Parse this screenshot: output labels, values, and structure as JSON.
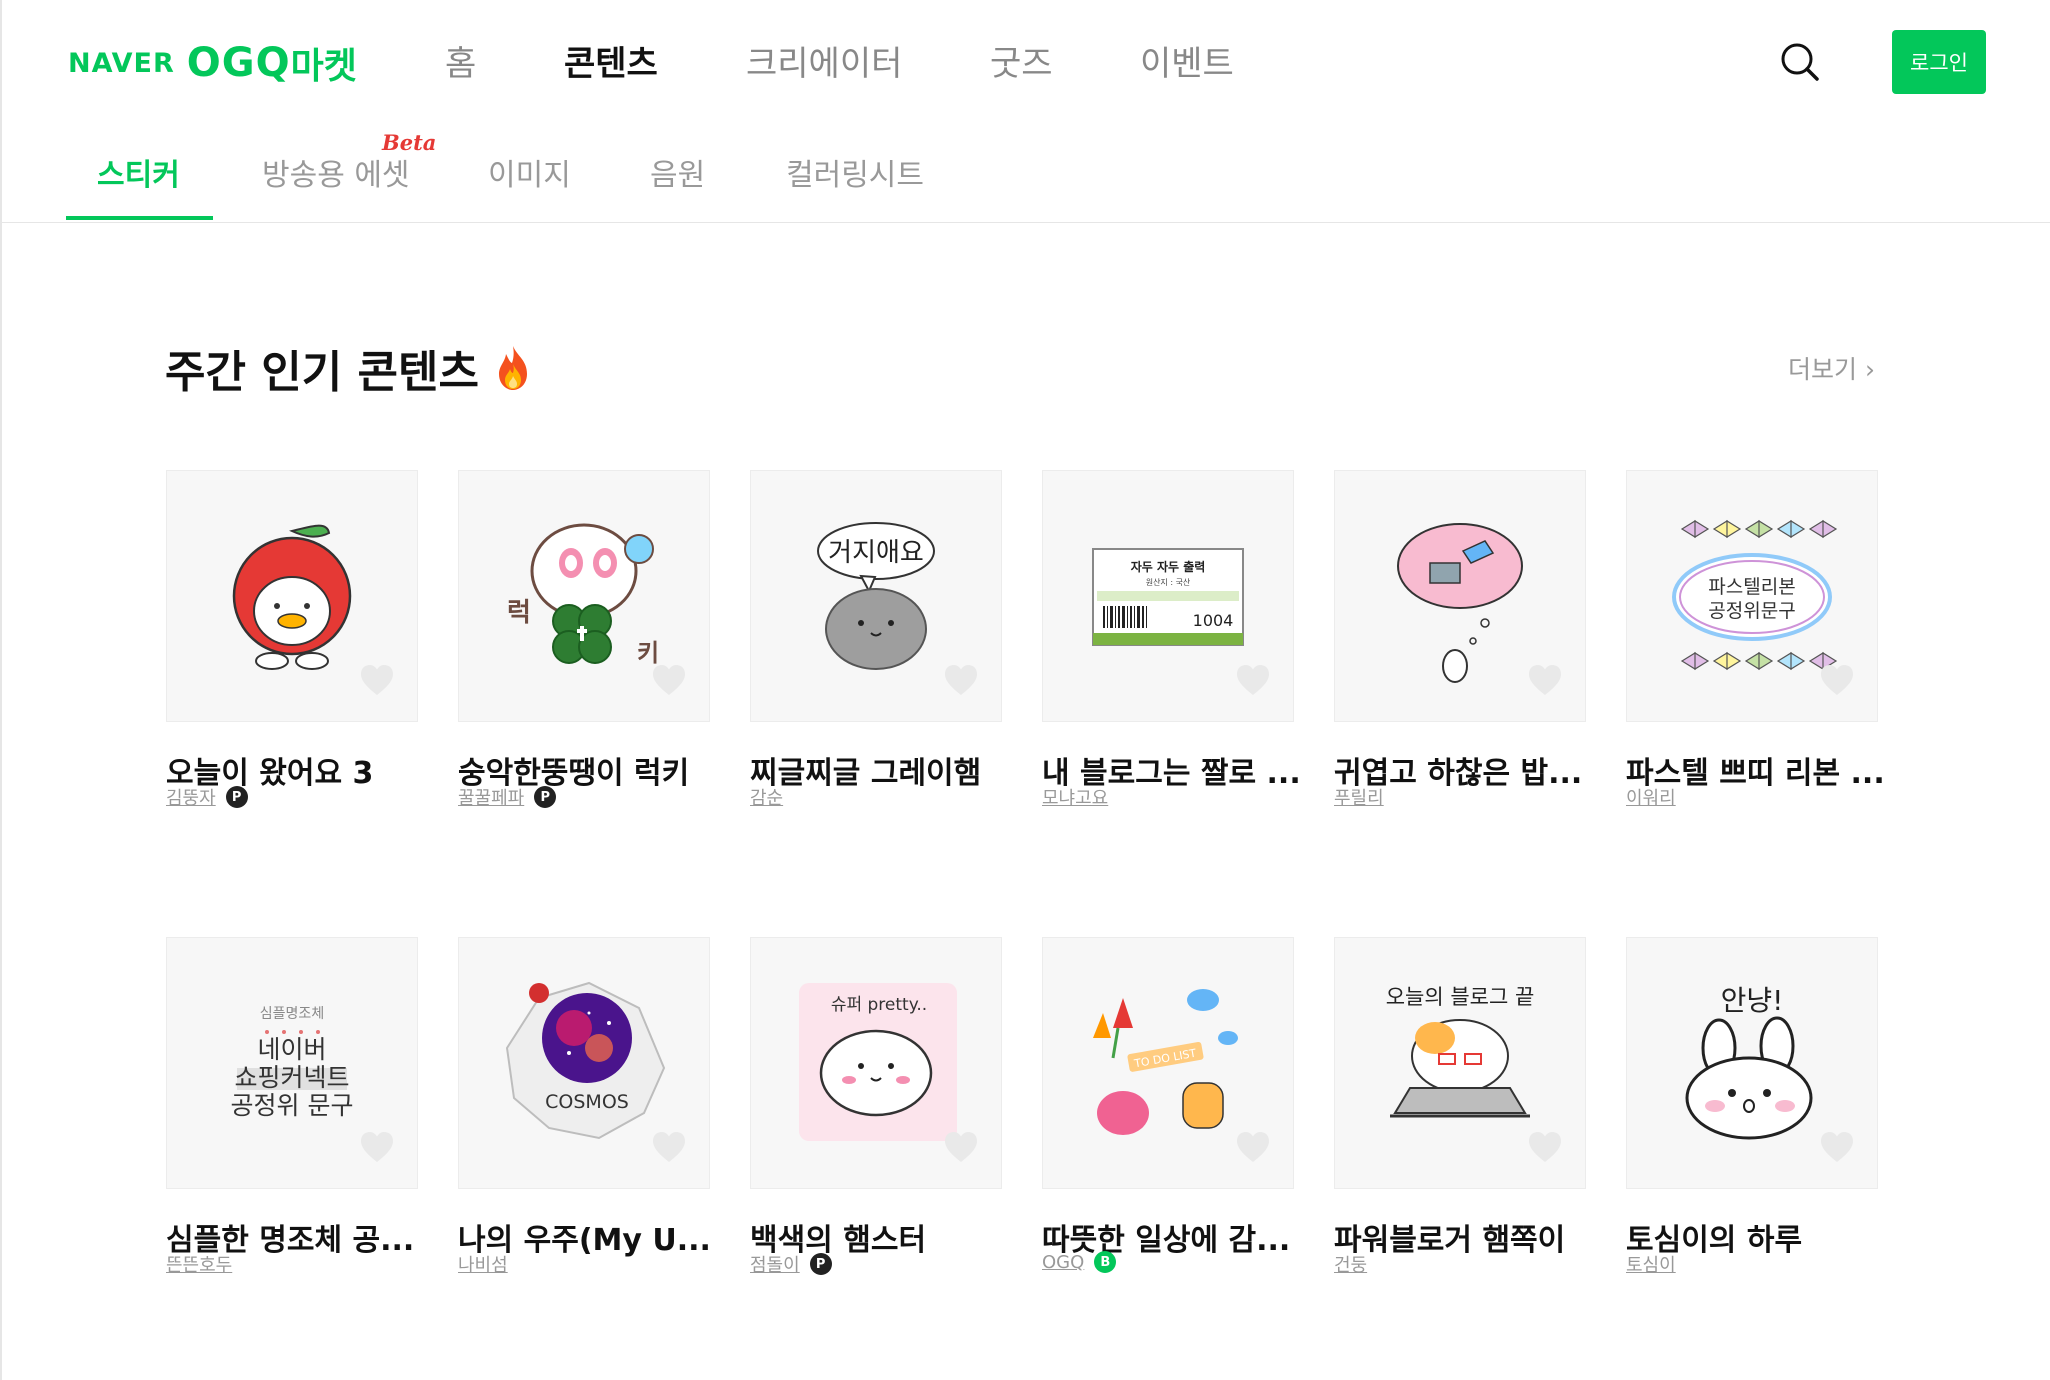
{
  "brand": {
    "naver": "NAVER",
    "ogq": "OGQ",
    "market": "마켓"
  },
  "gnb": {
    "items": [
      "홈",
      "콘텐츠",
      "크리에이터",
      "굿즈",
      "이벤트"
    ],
    "active_index": 1
  },
  "header": {
    "login_label": "로그인",
    "search_icon": "search-icon"
  },
  "subtabs": {
    "items": [
      "스티커",
      "방송용 에셋",
      "이미지",
      "음원",
      "컬러링시트"
    ],
    "active_index": 0,
    "beta_label": "Beta"
  },
  "section": {
    "title": "주간 인기 콘텐츠",
    "more_label": "더보기"
  },
  "cards": [
    {
      "title": "오늘이 왔어요 3",
      "author": "김뚱자",
      "badge": "P"
    },
    {
      "title": "숭악한뚱땡이 럭키",
      "author": "꿀꿀페파",
      "badge": "P"
    },
    {
      "title": "찌글찌글 그레이햄",
      "author": "감순",
      "badge": ""
    },
    {
      "title": "내 블로그는 짤로 ...",
      "author": "모냐고요",
      "badge": ""
    },
    {
      "title": "귀엽고 하찮은 밥...",
      "author": "푸릴리",
      "badge": ""
    },
    {
      "title": "파스텔 쁘띠 리본 ...",
      "author": "이워리",
      "badge": ""
    },
    {
      "title": "심플한 명조체 공...",
      "author": "뜬뜬호두",
      "badge": ""
    },
    {
      "title": "나의 우주(My U...",
      "author": "나비섬",
      "badge": ""
    },
    {
      "title": "백색의 햄스터",
      "author": "점돌이",
      "badge": "P"
    },
    {
      "title": "따뜻한 일상에 감...",
      "author": "OGQ",
      "badge": "B"
    },
    {
      "title": "파워블로거 햄쪽이",
      "author": "건둥",
      "badge": ""
    },
    {
      "title": "토심이의 하루",
      "author": "토심이",
      "badge": ""
    }
  ],
  "artwork_text": {
    "c3": "거지애요",
    "c2_a": "럭",
    "c2_b": "키",
    "c4_title": "자두 자두 출력",
    "c4_sub": "원산지 : 국산",
    "c4_num": "1004",
    "c6_a": "파스텔리본",
    "c6_b": "공정위문구",
    "c7_small": "심플명조체",
    "c7_a": "네이버",
    "c7_b": "쇼핑커넥트",
    "c7_c": "공정위 문구",
    "c8": "COSMOS",
    "c9": "슈퍼 pretty..",
    "c10": "TO DO LIST",
    "c11": "오늘의 블로그 끝",
    "c12": "안냥!"
  },
  "colors": {
    "accent": "#03c75a",
    "beta": "#e53935"
  }
}
